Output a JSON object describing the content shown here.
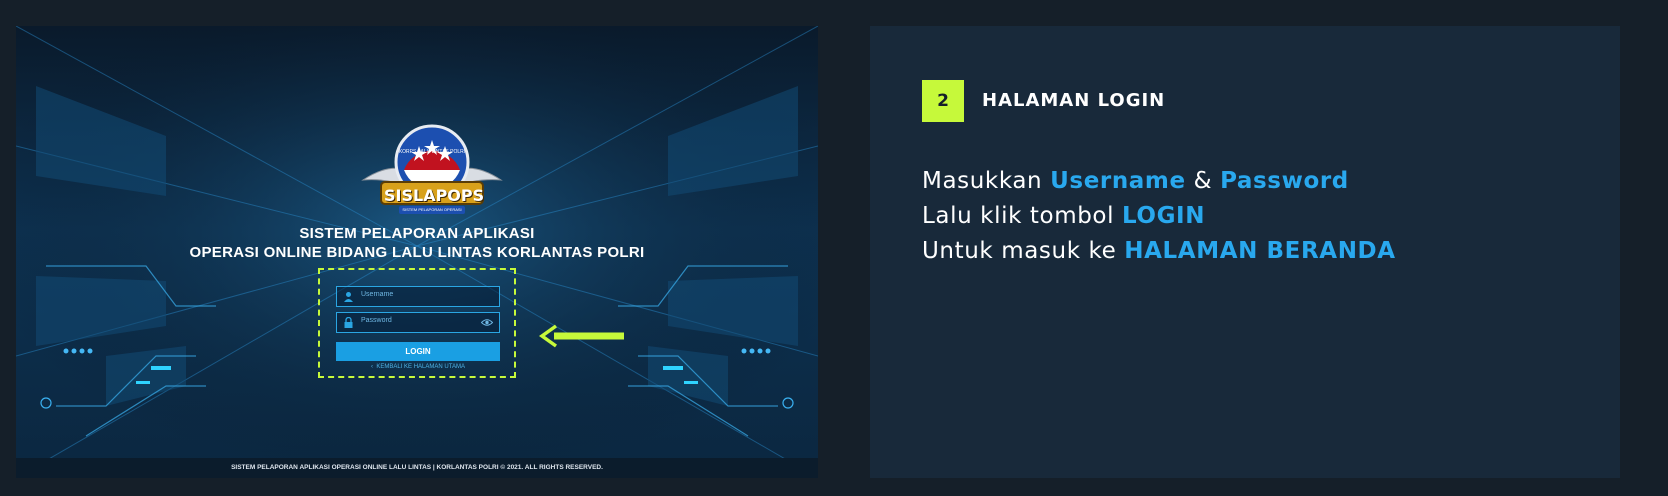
{
  "screenshot": {
    "app_title_line1": "SISTEM PELAPORAN APLIKASI",
    "app_title_line2": "OPERASI ONLINE BIDANG LALU LINTAS KORLANTAS POLRI",
    "logo": {
      "name": "SISLAPOPS",
      "ring_text": "KORPS LALU LINTAS POLRI",
      "subtitle": "SISTEM PELAPORAN OPERASI"
    },
    "form": {
      "username_placeholder": "Username",
      "password_placeholder": "Password",
      "login_label": "LOGIN",
      "back_label": "KEMBALI KE HALAMAN UTAMA"
    },
    "footer": "SISTEM PELAPORAN APLIKASI OPERASI ONLINE LALU LINTAS | KORLANTAS POLRI © 2021. ALL RIGHTS RESERVED."
  },
  "step": {
    "number": "2",
    "title": "HALAMAN LOGIN"
  },
  "instructions": {
    "line1_pre": "Masukkan ",
    "line1_hl1": "Username",
    "line1_mid": " & ",
    "line1_hl2": "Password",
    "line2_pre": "Lalu klik tombol ",
    "line2_hl": "LOGIN",
    "line3_pre": "Untuk masuk ke ",
    "line3_hl": "HALAMAN BERANDA"
  },
  "colors": {
    "accent_green": "#c6f93a",
    "accent_blue": "#29a8ee",
    "background": "#151f29",
    "panel": "#18293a"
  },
  "icons": [
    "user-icon",
    "lock-icon",
    "eye-icon",
    "chevron-left-icon",
    "arrow-left-icon"
  ]
}
